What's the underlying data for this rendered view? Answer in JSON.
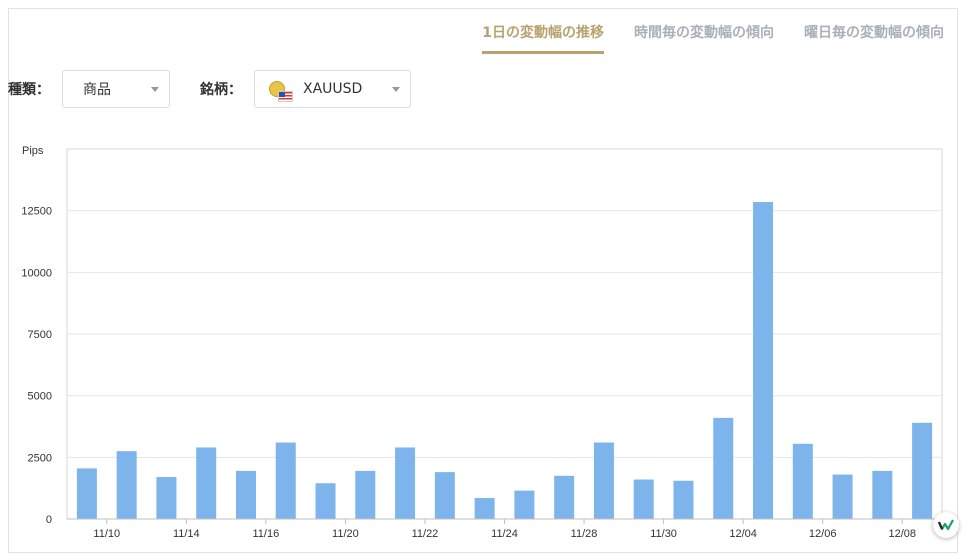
{
  "tabs": [
    {
      "label": "1日の変動幅の推移",
      "active": true
    },
    {
      "label": "時間毎の変動幅の傾向",
      "active": false
    },
    {
      "label": "曜日毎の変動幅の傾向",
      "active": false
    }
  ],
  "filters": {
    "type_label": "種類：",
    "type_value": "商品",
    "symbol_label": "銘柄：",
    "symbol_value": "XAUUSD"
  },
  "icons": {
    "symbol_icon": "gold-coin-us-flag-icon",
    "corner_badge": "brand-logo-icon"
  },
  "colors": {
    "bar": "#7db4ec",
    "active_tab": "#b9a26f",
    "inactive_tab": "#a9b0b8",
    "grid": "#e6e6e6"
  },
  "chart_data": {
    "type": "bar",
    "ylabel": "Pips",
    "ylim": [
      0,
      15000
    ],
    "yticks": [
      0,
      2500,
      5000,
      7500,
      10000,
      12500
    ],
    "xtick_labels": [
      "11/10",
      "11/14",
      "11/16",
      "11/20",
      "11/22",
      "11/24",
      "11/28",
      "11/30",
      "12/04",
      "12/06",
      "12/08"
    ],
    "values": [
      2050,
      2750,
      1700,
      2900,
      1950,
      3100,
      1450,
      1950,
      2900,
      1900,
      850,
      1150,
      1750,
      3100,
      1600,
      1550,
      4100,
      12850,
      3050,
      1800,
      1950,
      3900
    ],
    "grid": true
  }
}
